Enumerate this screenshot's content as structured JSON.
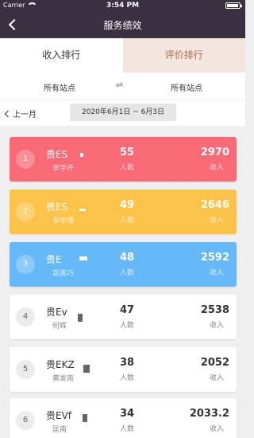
{
  "status": {
    "carrier": "Carrier",
    "time": "3:54 PM"
  },
  "nav": {
    "title": "服务绩效"
  },
  "tabs": [
    {
      "label": "收入排行"
    },
    {
      "label": "评价排行"
    }
  ],
  "stations": {
    "left": "所有站点",
    "right": "所有站点",
    "swap": "⇌"
  },
  "date": {
    "prev": "上一月",
    "range": "2020年6月1日 ~ 6月3日"
  },
  "list": [
    {
      "rank": "1",
      "name": "贵ES",
      "sub": "李学开",
      "count": "55",
      "count_label": "人数",
      "income": "2970",
      "income_label": "收入",
      "color": "#f76a76"
    },
    {
      "rank": "2",
      "name": "贵ES",
      "sub": "李学博",
      "count": "49",
      "count_label": "人数",
      "income": "2646",
      "income_label": "收入",
      "color": "#fbc34a"
    },
    {
      "rank": "3",
      "name": "贵E",
      "sub": "郭真巧",
      "count": "48",
      "count_label": "人数",
      "income": "2592",
      "income_label": "收入",
      "color": "#66b9f7"
    },
    {
      "rank": "4",
      "name": "贵Ev",
      "sub": "何辉",
      "count": "47",
      "count_label": "人数",
      "income": "2538",
      "income_label": "收入",
      "color": "#ffffff"
    },
    {
      "rank": "5",
      "name": "贵EKZ",
      "sub": "黄发雨",
      "count": "38",
      "count_label": "人数",
      "income": "2052",
      "income_label": "收入",
      "color": "#ffffff"
    },
    {
      "rank": "6",
      "name": "贵EVf",
      "sub": "匡南",
      "count": "34",
      "count_label": "人数",
      "income": "2033.2",
      "income_label": "收入",
      "color": "#ffffff"
    }
  ]
}
